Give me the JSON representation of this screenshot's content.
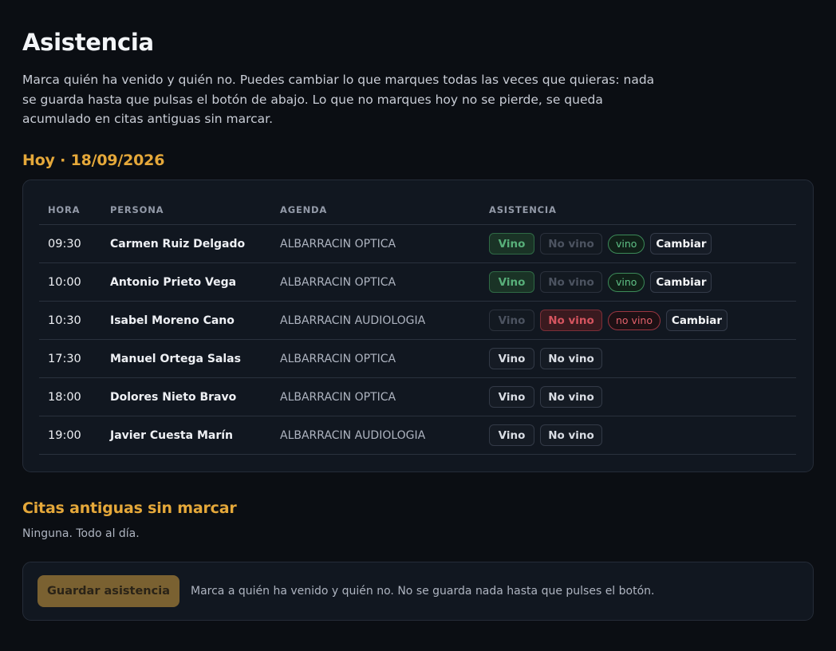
{
  "page": {
    "title": "Asistencia",
    "intro": "Marca quién ha venido y quién no. Puedes cambiar lo que marques todas las veces que quieras: nada se guarda hasta que pulsas el botón de abajo. Lo que no marques hoy no se pierde, se queda acumulado en citas antiguas sin marcar."
  },
  "today": {
    "title": "Hoy · 18/09/2026",
    "columns": {
      "hora": "HORA",
      "persona": "PERSONA",
      "agenda": "AGENDA",
      "asistencia": "ASISTENCIA"
    },
    "buttons": {
      "vino": "Vino",
      "no_vino": "No vino",
      "cambiar": "Cambiar"
    },
    "rows": [
      {
        "hora": "09:30",
        "persona": "Carmen Ruiz Delgado",
        "agenda": "ALBARRACIN OPTICA",
        "status": "vino",
        "status_label": "vino"
      },
      {
        "hora": "10:00",
        "persona": "Antonio Prieto Vega",
        "agenda": "ALBARRACIN OPTICA",
        "status": "vino",
        "status_label": "vino"
      },
      {
        "hora": "10:30",
        "persona": "Isabel Moreno Cano",
        "agenda": "ALBARRACIN AUDIOLOGIA",
        "status": "no_vino",
        "status_label": "no vino"
      },
      {
        "hora": "17:30",
        "persona": "Manuel Ortega Salas",
        "agenda": "ALBARRACIN OPTICA",
        "status": "none",
        "status_label": ""
      },
      {
        "hora": "18:00",
        "persona": "Dolores Nieto Bravo",
        "agenda": "ALBARRACIN OPTICA",
        "status": "none",
        "status_label": ""
      },
      {
        "hora": "19:00",
        "persona": "Javier Cuesta Marín",
        "agenda": "ALBARRACIN AUDIOLOGIA",
        "status": "none",
        "status_label": ""
      }
    ]
  },
  "old": {
    "title": "Citas antiguas sin marcar",
    "text": "Ninguna. Todo al día."
  },
  "save": {
    "button": "Guardar asistencia",
    "hint": "Marca a quién ha venido y quién no. No se guarda nada hasta que pulses el botón."
  },
  "colors": {
    "background": "#0b0e13",
    "accent": "#e5a83a",
    "vino_green": "#58b07a",
    "no_vino_red": "#d5545f",
    "save_button": "#7a6131"
  }
}
